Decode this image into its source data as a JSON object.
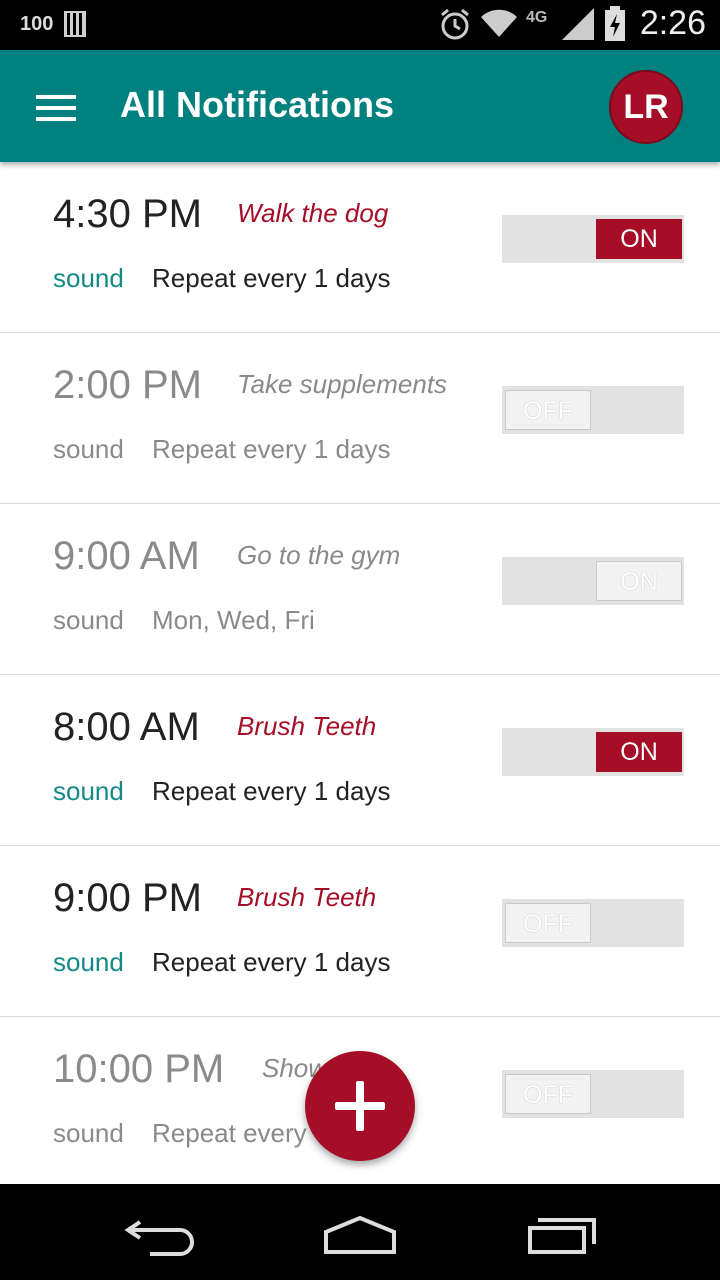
{
  "status_bar": {
    "battery_text": "100",
    "network": "4G LTE",
    "time": "2:26"
  },
  "app_bar": {
    "title": "All Notifications",
    "avatar_initials": "LR"
  },
  "notifications": [
    {
      "time": "4:30 PM",
      "label": "Walk the dog",
      "sound": "sound",
      "repeat": "Repeat every 1 days",
      "toggle": "ON",
      "enabled": true
    },
    {
      "time": "2:00 PM",
      "label": "Take supplements",
      "sound": "sound",
      "repeat": "Repeat every 1 days",
      "toggle": "OFF",
      "enabled": false
    },
    {
      "time": "9:00 AM",
      "label": "Go to the gym",
      "sound": "sound",
      "repeat": "Mon, Wed, Fri",
      "toggle": "ON",
      "enabled": false
    },
    {
      "time": "8:00 AM",
      "label": "Brush Teeth",
      "sound": "sound",
      "repeat": "Repeat every 1 days",
      "toggle": "ON",
      "enabled": true
    },
    {
      "time": "9:00 PM",
      "label": "Brush Teeth",
      "sound": "sound",
      "repeat": "Repeat every 1 days",
      "toggle": "OFF",
      "enabled": true
    },
    {
      "time": "10:00 PM",
      "label": "Show",
      "sound": "sound",
      "repeat": "Repeat every",
      "toggle": "OFF",
      "enabled": false
    }
  ],
  "colors": {
    "app_bar": "#00807F",
    "accent": "#A50E26",
    "sound": "#138A86"
  },
  "icons": {
    "menu": "hamburger-menu-icon",
    "fab": "plus-icon",
    "back": "back-icon",
    "home": "home-icon",
    "recents": "recents-icon"
  }
}
